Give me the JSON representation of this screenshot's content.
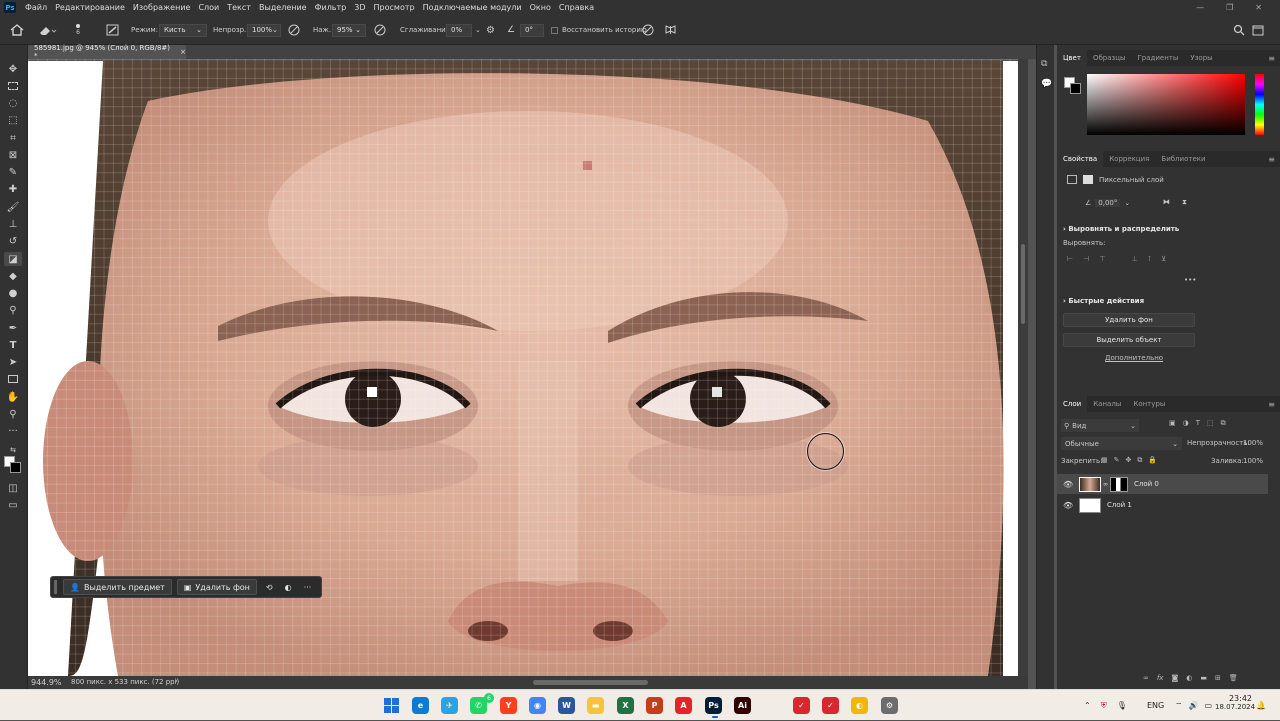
{
  "app": {
    "logo": "Ps"
  },
  "menu": [
    "Файл",
    "Редактирование",
    "Изображение",
    "Слои",
    "Текст",
    "Выделение",
    "Фильтр",
    "3D",
    "Просмотр",
    "Подключаемые модули",
    "Окно",
    "Справка"
  ],
  "window_controls": [
    "—",
    "❐",
    "✕"
  ],
  "options": {
    "brush_size": "6",
    "mode_label": "Режим:",
    "mode_value": "Кисть",
    "opacity_label": "Непрозр.:",
    "opacity_value": "100%",
    "pressure_label": "Наж.:",
    "pressure_value": "95%",
    "smoothing_label": "Сглаживание:",
    "smoothing_value": "0%",
    "angle_value": "0°",
    "restore_history_label": "Восстановить историю"
  },
  "document": {
    "tab_title": "585981.jpg @ 945% (Слой 0, RGB/8#) *",
    "tab_close": "×"
  },
  "status": {
    "zoom": "944.9%",
    "doc_info": "800 пикс. x 533 пикс. (72 ppi)",
    "arrow": "›"
  },
  "context_bar": {
    "select_subject": "Выделить предмет",
    "remove_bg": "Удалить фон",
    "more": "···"
  },
  "color_panel": {
    "tabs": [
      "Цвет",
      "Образцы",
      "Градиенты",
      "Узоры"
    ],
    "active": "Цвет",
    "accent": "#ff0000"
  },
  "properties_panel": {
    "tabs": [
      "Свойства",
      "Коррекция",
      "Библиотеки"
    ],
    "layer_type": "Пиксельный слой",
    "angle": "0,00°",
    "align_section": "Выровнять и распределить",
    "align_label": "Выровнять:",
    "align_more": "•••",
    "quick_actions": "Быстрые действия",
    "remove_bg_btn": "Удалить фон",
    "select_object_btn": "Выделить объект",
    "more_link": "Дополнительно"
  },
  "layers_panel": {
    "tabs": [
      "Слои",
      "Каналы",
      "Контуры"
    ],
    "filter_kind": "Вид",
    "blend_mode": "Обычные",
    "opacity_label": "Непрозрачность:",
    "opacity_value": "100%",
    "lock_label": "Закрепить:",
    "fill_label": "Заливка:",
    "fill_value": "100%",
    "layers": [
      {
        "name": "Слой 0",
        "selected": true
      },
      {
        "name": "Слой 1",
        "selected": false
      }
    ]
  },
  "taskbar": {
    "apps": [
      {
        "name": "windows-start",
        "label": "",
        "color": "#1e6fd9"
      },
      {
        "name": "edge",
        "label": "e",
        "color": "#0c7bd1"
      },
      {
        "name": "telegram",
        "label": "✈",
        "color": "#2aa3df"
      },
      {
        "name": "whatsapp",
        "label": "✆",
        "color": "#25d366"
      },
      {
        "name": "yandex",
        "label": "Y",
        "color": "#fc3f1d"
      },
      {
        "name": "chrome",
        "label": "◉",
        "color": "#4285f4"
      },
      {
        "name": "word",
        "label": "W",
        "color": "#2b579a"
      },
      {
        "name": "explorer",
        "label": "▬",
        "color": "#f7c33b"
      },
      {
        "name": "excel",
        "label": "X",
        "color": "#207245"
      },
      {
        "name": "powerpoint",
        "label": "P",
        "color": "#c43e1c"
      },
      {
        "name": "acrobat",
        "label": "A",
        "color": "#e3242b"
      },
      {
        "name": "photoshop",
        "label": "Ps",
        "color": "#001e36"
      },
      {
        "name": "illustrator",
        "label": "Ai",
        "color": "#330000"
      },
      {
        "name": "app-red-1",
        "label": "✓",
        "color": "#d7282f"
      },
      {
        "name": "app-red-2",
        "label": "✓",
        "color": "#d7282f"
      },
      {
        "name": "app-yellow",
        "label": "◐",
        "color": "#f2b705"
      },
      {
        "name": "app-gray",
        "label": "⚙",
        "color": "#6c6c6c"
      }
    ],
    "whatsapp_badge": "6",
    "lang": "ENG",
    "time": "23:42",
    "date": "18.07.2024"
  }
}
